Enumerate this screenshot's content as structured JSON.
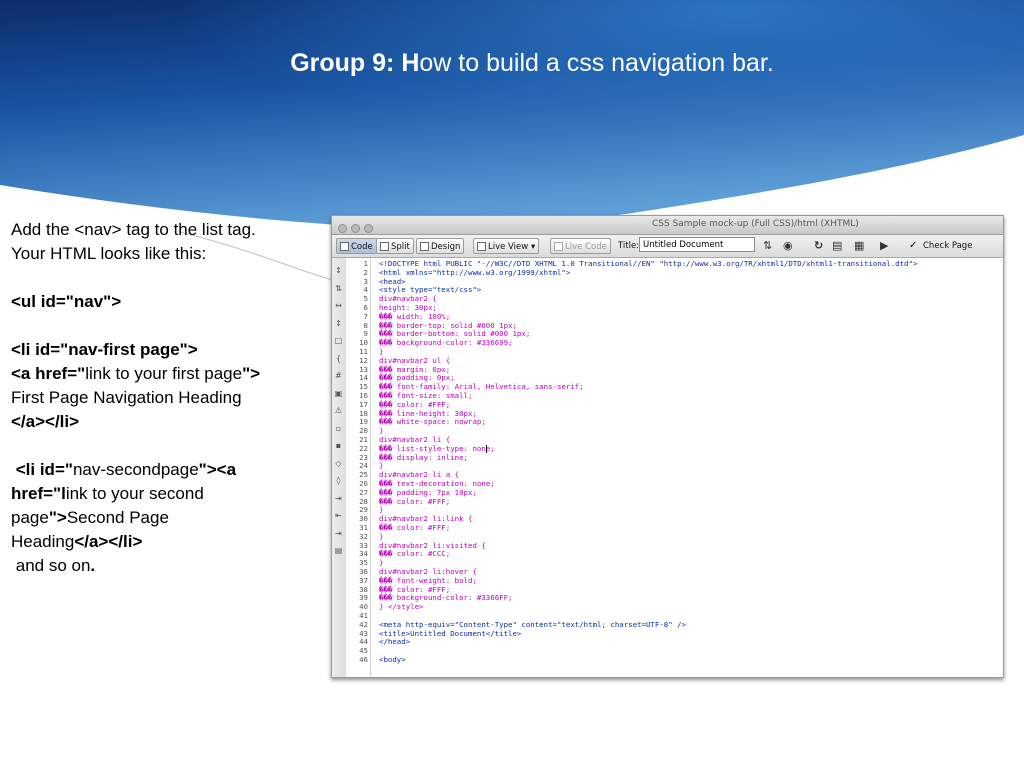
{
  "slide": {
    "title_bold": "Group 9: H",
    "title_rest": "ow to build a css navigation bar."
  },
  "colors": {
    "header_dark": "#0b2c6b",
    "header_mid": "#1e63b0",
    "header_light": "#5e9fd8",
    "code_tag": "#0a2ea8",
    "code_selector": "#c000c0"
  },
  "body": {
    "line1": "Add the <nav> tag to the list tag.",
    "line2": "Your HTML looks like this:",
    "ul_tag": "<ul id=\"nav\">",
    "li_first": "<li id=\"nav-first page\">",
    "a_first_open": "<a href=\"",
    "a_first_link": "link to your first page",
    "a_first_close": "\">",
    "first_heading": "First Page Navigation Heading",
    "first_end": "</a></li>",
    "li_second_open": "<li id=\"",
    "li_second_id": "nav-secondpage",
    "li_second_close": "\"><a",
    "href_second_open": "href=\"l",
    "href_second_link": "ink to your second",
    "page_word": "page",
    "page_close": "\">",
    "second_heading_a": "Second Page",
    "second_heading_b": "Heading",
    "second_end": "</a></li>",
    "and_so_on": "and so on",
    "period": "."
  },
  "screenshot": {
    "window_title": "CSS Sample mock-up (Full CSS)/html (XHTML)",
    "toolbar": {
      "code": "Code",
      "split": "Split",
      "design": "Design",
      "live_view": "Live View",
      "live_code": "Live Code",
      "title_label": "Title:",
      "title_value": "Untitled Document",
      "check_page": "Check Page"
    },
    "line_numbers": [
      "1",
      "2",
      "3",
      "4",
      "5",
      "6",
      "7",
      "8",
      "9",
      "10",
      "11",
      "12",
      "13",
      "14",
      "15",
      "16",
      "17",
      "18",
      "19",
      "20",
      "21",
      "22",
      "23",
      "24",
      "25",
      "26",
      "27",
      "28",
      "29",
      "30",
      "31",
      "32",
      "33",
      "34",
      "35",
      "36",
      "37",
      "38",
      "39",
      "40",
      "41",
      "42",
      "43",
      "44",
      "45",
      "46"
    ],
    "code_lines": [
      {
        "t": "tag",
        "v": "<!DOCTYPE html PUBLIC \"-//W3C//DTD XHTML 1.0 Transitional//EN\" \"http://www.w3.org/TR/xhtml1/DTD/xhtml1-transitional.dtd\">"
      },
      {
        "t": "tag",
        "v": "<html xmlns=\"http://www.w3.org/1999/xhtml\">"
      },
      {
        "t": "tag",
        "v": "<head>"
      },
      {
        "t": "tag",
        "v": "<style type=\"text/css\">"
      },
      {
        "t": "sel",
        "v": "div#navbar2 {"
      },
      {
        "t": "sel",
        "v": "height: 30px;"
      },
      {
        "t": "sel",
        "v": "��� width: 100%;"
      },
      {
        "t": "sel",
        "v": "��� border-top: solid #000 1px;"
      },
      {
        "t": "sel",
        "v": "��� border-bottom: solid #000 1px;"
      },
      {
        "t": "sel",
        "v": "��� background-color: #336699;"
      },
      {
        "t": "sel",
        "v": "}"
      },
      {
        "t": "sel",
        "v": "div#navbar2 ul {"
      },
      {
        "t": "sel",
        "v": "��� margin: 0px;"
      },
      {
        "t": "sel",
        "v": "��� padding: 0px;"
      },
      {
        "t": "sel",
        "v": "��� font-family: Arial, Helvetica, sans-serif;"
      },
      {
        "t": "sel",
        "v": "��� font-size: small;"
      },
      {
        "t": "sel",
        "v": "��� color: #FFF;"
      },
      {
        "t": "sel",
        "v": "��� line-height: 30px;"
      },
      {
        "t": "sel",
        "v": "��� white-space: nowrap;"
      },
      {
        "t": "sel",
        "v": "}"
      },
      {
        "t": "sel",
        "v": "div#navbar2 li {"
      },
      {
        "t": "sel",
        "v": "��� list-style-type: none;"
      },
      {
        "t": "sel",
        "v": "��� display: inline;"
      },
      {
        "t": "sel",
        "v": "}"
      },
      {
        "t": "sel",
        "v": "div#navbar2 li a {"
      },
      {
        "t": "sel",
        "v": "��� text-decoration: none;"
      },
      {
        "t": "sel",
        "v": "��� padding: 7px 10px;"
      },
      {
        "t": "sel",
        "v": "��� color: #FFF;"
      },
      {
        "t": "sel",
        "v": "}"
      },
      {
        "t": "sel",
        "v": "div#navbar2 li:link {"
      },
      {
        "t": "sel",
        "v": "��� color: #FFF;"
      },
      {
        "t": "sel",
        "v": "}"
      },
      {
        "t": "sel",
        "v": "div#navbar2 li:visited {"
      },
      {
        "t": "sel",
        "v": "��� color: #CCC;"
      },
      {
        "t": "sel",
        "v": "}"
      },
      {
        "t": "sel",
        "v": "div#navbar2 li:hover {"
      },
      {
        "t": "sel",
        "v": "��� font-weight: bold;"
      },
      {
        "t": "sel",
        "v": "��� color: #FFF;"
      },
      {
        "t": "sel",
        "v": "��� background-color: #3366FF;"
      },
      {
        "t": "sel",
        "v": "} </style>"
      },
      {
        "t": "plain",
        "v": ""
      },
      {
        "t": "tag",
        "v": "<meta http-equiv=\"Content-Type\" content=\"text/html; charset=UTF-8\" />"
      },
      {
        "t": "tag",
        "v": "<title>Untitled Document</title>"
      },
      {
        "t": "tag",
        "v": "</head>"
      },
      {
        "t": "plain",
        "v": ""
      },
      {
        "t": "tag",
        "v": "<body>"
      }
    ]
  }
}
